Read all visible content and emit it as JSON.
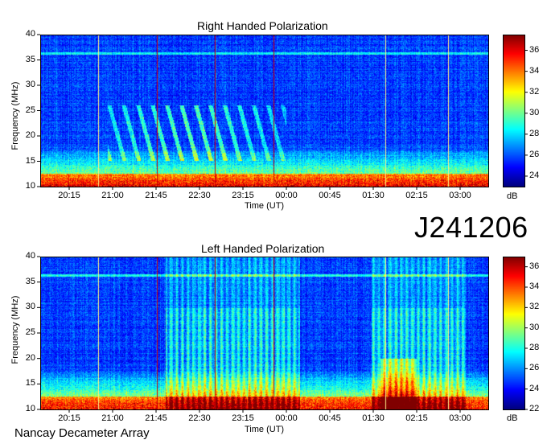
{
  "observation_id": "J241206",
  "instrument": "Nancay Decameter Array",
  "chart_data": [
    {
      "type": "heatmap",
      "title": "Right Handed Polarization",
      "xlabel": "Time (UT)",
      "ylabel": "Frequency (MHz)",
      "x_ticks": [
        "20:15",
        "21:00",
        "21:45",
        "22:30",
        "23:15",
        "00:00",
        "00:45",
        "01:30",
        "02:15",
        "03:00"
      ],
      "y_ticks": [
        10,
        15,
        20,
        25,
        30,
        35,
        40
      ],
      "ylim": [
        10,
        40
      ],
      "colorbar_label": "dB",
      "colorbar_ticks": [
        24,
        26,
        28,
        30,
        32,
        34,
        36
      ],
      "colorbar_range": [
        23,
        37.5
      ],
      "colormap": "jet",
      "notes": "Strong emission below ~18 MHz throughout; bursty arcs 19-26 MHz from ~21:15 to ~23:45 UT"
    },
    {
      "type": "heatmap",
      "title": "Left Handed Polarization",
      "xlabel": "Time (UT)",
      "ylabel": "Frequency (MHz)",
      "x_ticks": [
        "20:15",
        "21:00",
        "21:45",
        "22:30",
        "23:15",
        "00:00",
        "00:45",
        "01:30",
        "02:15",
        "03:00"
      ],
      "y_ticks": [
        10,
        15,
        20,
        25,
        30,
        35,
        40
      ],
      "ylim": [
        10,
        40
      ],
      "colorbar_label": "dB",
      "colorbar_ticks": [
        22,
        24,
        26,
        28,
        30,
        32,
        34,
        36
      ],
      "colorbar_range": [
        22,
        37
      ],
      "colormap": "jet",
      "notes": "Strong emission below ~17 MHz; broadband enhancement ~21:45-00:30 UT and ~01:15-03:30 UT"
    }
  ]
}
